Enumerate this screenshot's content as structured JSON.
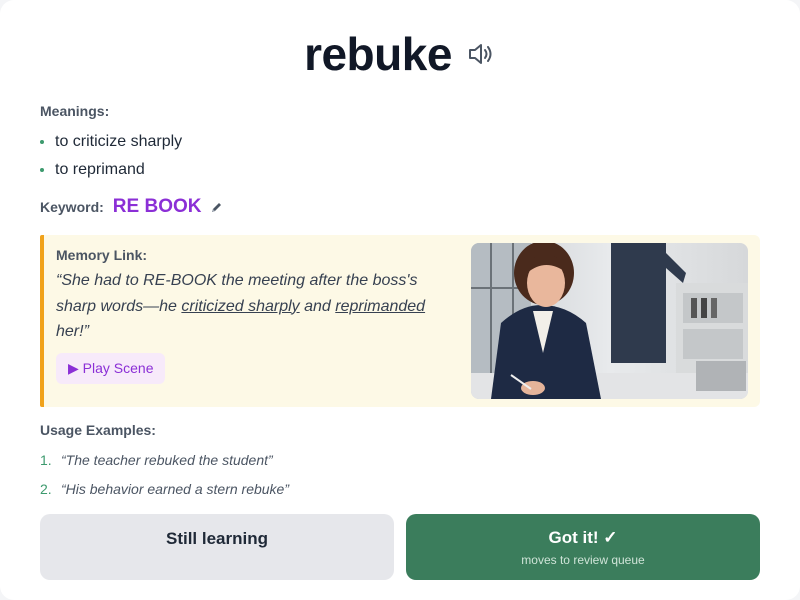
{
  "word": "rebuke",
  "meanings_label": "Meanings:",
  "meanings": [
    "to criticize sharply",
    "to reprimand"
  ],
  "keyword_label": "Keyword:",
  "keyword": "RE BOOK",
  "memory_label": "Memory Link:",
  "memory": {
    "part1": "“She had to RE-BOOK the meeting after the boss's sharp words—he ",
    "u1": "criticized sharply",
    "part2": " and ",
    "u2": "reprimanded",
    "part3": " her!”"
  },
  "play_label": "▶ Play Scene",
  "examples_label": "Usage Examples:",
  "examples": [
    {
      "num": "1.",
      "text": "“The teacher rebuked the student”"
    },
    {
      "num": "2.",
      "text": "“His behavior earned a stern rebuke”"
    }
  ],
  "buttons": {
    "still_learning": "Still learning",
    "got_it": "Got it! ✓",
    "got_it_sub": "moves to review queue"
  },
  "colors": {
    "accent_purple": "#8b2fd6",
    "accent_green": "#3b7d5c",
    "memory_bg": "#fdf9e6",
    "memory_border": "#f0a21b"
  }
}
